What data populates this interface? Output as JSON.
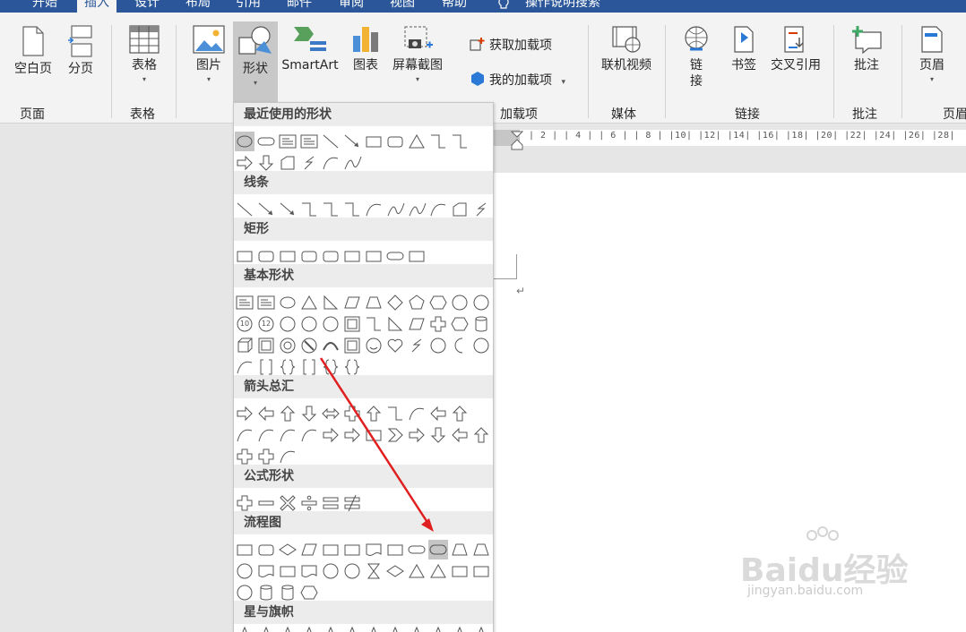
{
  "tabs": [
    "开始",
    "插入",
    "设计",
    "布局",
    "引用",
    "邮件",
    "审阅",
    "视图",
    "帮助"
  ],
  "tell_me": "操作说明搜索",
  "ribbon": {
    "blank_page": "空白页",
    "page_break": "分页",
    "table": "表格",
    "picture": "图片",
    "shapes": "形状",
    "smartart": "SmartArt",
    "chart": "图表",
    "screenshot": "屏幕截图",
    "get_addins": "获取加载项",
    "my_addins": "我的加载项",
    "online_video": "联机视频",
    "link": "链接",
    "bookmark": "书签",
    "cross_ref": "交叉引用",
    "comment": "批注",
    "header": "页眉",
    "groups": {
      "pages": "页面",
      "tables": "表格",
      "addins": "加载项",
      "media": "媒体",
      "links": "链接",
      "comments": "批注",
      "header_footer": "页眉"
    }
  },
  "ruler": "| 2 |   | 4 |   | 6 |   | 8 |   |10|   |12|   |14|   |16|   |18|   |20|   |22|   |24|   |26|   |28|",
  "paragraph_mark": "↵",
  "gallery": {
    "sections": [
      "最近使用的形状",
      "线条",
      "矩形",
      "基本形状",
      "箭头总汇",
      "公式形状",
      "流程图",
      "星与旗帜"
    ],
    "basic_labels": [
      "10",
      "12"
    ],
    "selected_shape": "流程图: 终止"
  },
  "watermark": {
    "brand": "Baidu经验",
    "url": "jingyan.baidu.com"
  },
  "colors": {
    "tab_bar": "#2b579a",
    "ribbon_bg": "#f3f3f3",
    "selected": "#c5c5c5",
    "arrow": "#e02020"
  }
}
